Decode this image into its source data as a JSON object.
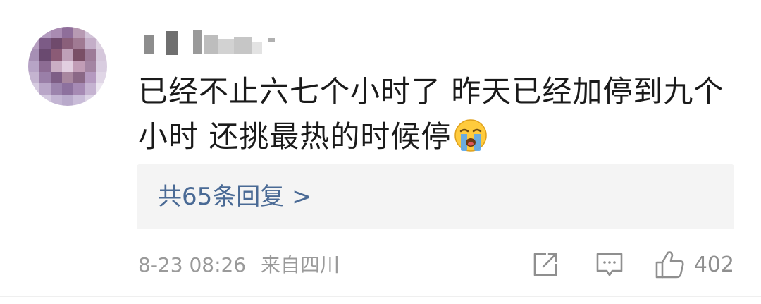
{
  "comment": {
    "text_line1": "已经不止六七个小时了  昨天已经加停到九个",
    "text_line2": "小时  还挑最热的时候停",
    "emoji": "loudly-crying-face"
  },
  "replies": {
    "label": "共65条回复 >"
  },
  "meta": {
    "time": "8-23 08:26",
    "location": "来自四川"
  },
  "actions": {
    "share_icon": "share-icon",
    "comment_icon": "comment-icon",
    "like_icon": "thumbs-up-icon",
    "like_count": "402"
  },
  "colors": {
    "link": "#4a6a95",
    "meta": "#9a9a9a",
    "reply_bg": "#f4f4f4",
    "text": "#1a1a1a"
  }
}
